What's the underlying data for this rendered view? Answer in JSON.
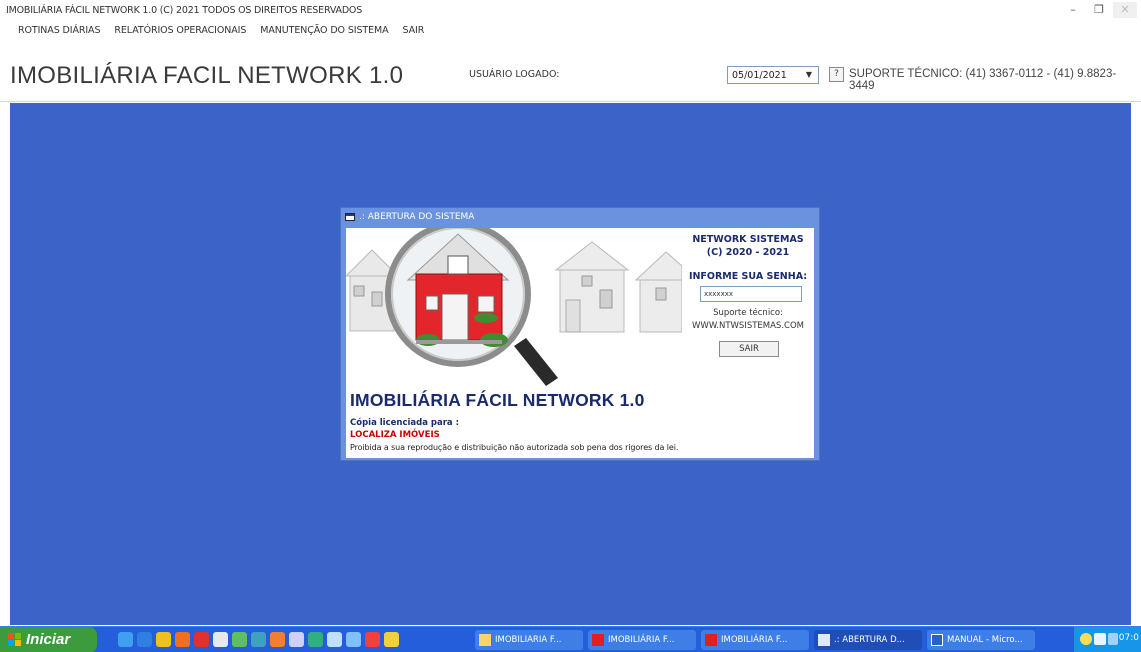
{
  "window": {
    "title": "IMOBILIÁRIA FÁCIL NETWORK 1.0  (C) 2021 TODOS OS DIREITOS RESERVADOS",
    "minimize": "–",
    "maximize": "❐",
    "close": "✕"
  },
  "menu": [
    {
      "label": "ROTINAS DIÁRIAS"
    },
    {
      "label": "RELATÓRIOS OPERACIONAIS"
    },
    {
      "label": "MANUTENÇÃO DO SISTEMA"
    },
    {
      "label": "SAIR"
    }
  ],
  "header": {
    "app_title": "IMOBILIÁRIA FACIL NETWORK 1.0",
    "user_label": "USUÁRIO LOGADO:",
    "date_value": "05/01/2021",
    "date_arrow": "▼",
    "help_label": "?",
    "support_text": "SUPORTE TÉCNICO: (41) 3367-0112 - (41) 9.8823-3449"
  },
  "dialog": {
    "title": ".: ABERTURA DO SISTEMA",
    "company": "NETWORK SISTEMAS",
    "copyright": "(C) 2020 - 2021",
    "password_prompt": "INFORME SUA SENHA:",
    "password_value": "xxxxxxx",
    "support_label": "Suporte técnico:",
    "website": "WWW.NTWSISTEMAS.COM",
    "exit_button": "SAIR",
    "product_title": "IMOBILIÁRIA FÁCIL NETWORK 1.0",
    "license_label": "Cópia licenciada para :",
    "licensee": "LOCALIZA IMÓVEIS",
    "notice": "Proibida a sua reprodução e distribuição não autorizada sob pena dos rigores da lei."
  },
  "taskbar": {
    "start_label": "Iniciar",
    "buttons": [
      {
        "label": "IMOBILIARIA F...",
        "icon": "folder-icon"
      },
      {
        "label": "IMOBILIÁRIA F...",
        "icon": "app-n-icon"
      },
      {
        "label": "IMOBILIÁRIA F...",
        "icon": "app-n-icon"
      },
      {
        "label": ".: ABERTURA D...",
        "icon": "window-icon"
      },
      {
        "label": "MANUAL - Micro...",
        "icon": "word-icon"
      }
    ],
    "clock": "07:0"
  },
  "colors": {
    "desktop": "#3b63c8",
    "dialog_frame": "#6a92de",
    "title_navy": "#1a2a6c",
    "licensee_red": "#cc0000",
    "taskbar": "#245edb",
    "start_green": "#3c9b3c"
  }
}
